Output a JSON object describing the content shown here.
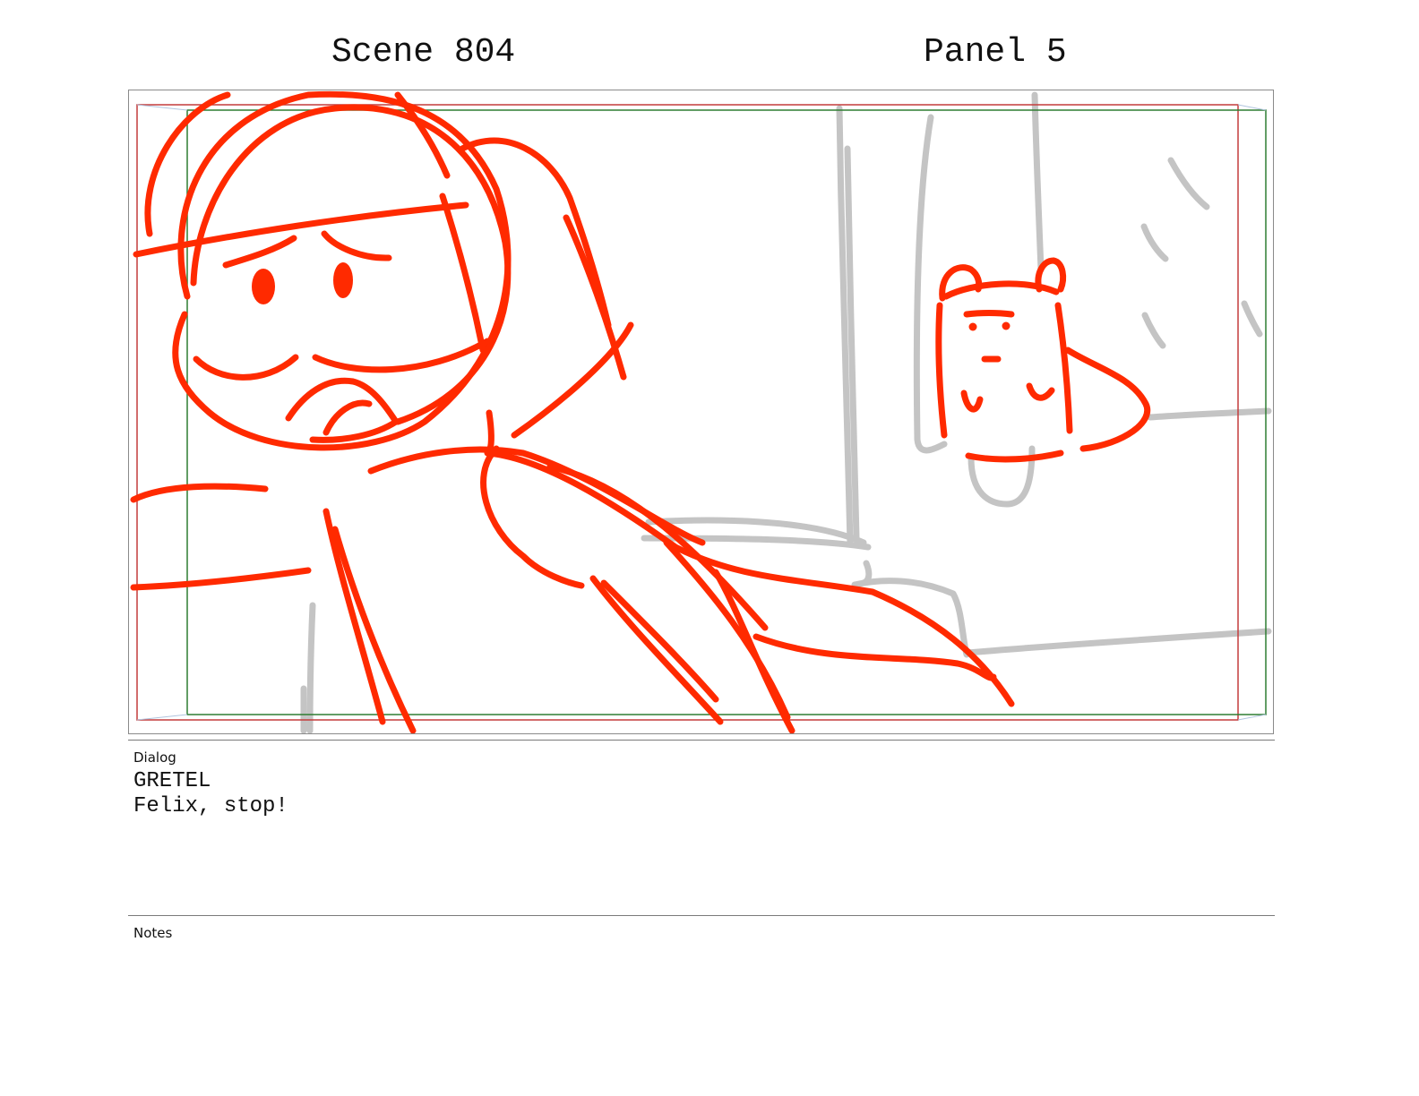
{
  "header": {
    "scene": "Scene 804",
    "panel": "Panel 5"
  },
  "colors": {
    "sketch_red": "#ff2a00",
    "sketch_gray": "#c4c4c4",
    "safe_frame_red": "#c43c3c",
    "safe_frame_green": "#2e7d32",
    "frame_border": "#8a8a8a"
  },
  "dialog": {
    "label": "Dialog",
    "character": "GRETEL",
    "line": "Felix, stop!"
  },
  "notes": {
    "label": "Notes",
    "text": ""
  }
}
